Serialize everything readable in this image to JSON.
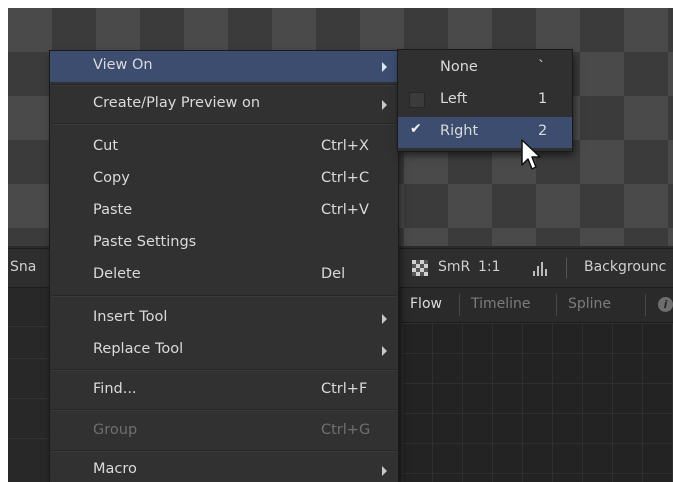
{
  "toolbar": {
    "left_text": "Sna",
    "smr_label": "SmR",
    "ratio_label": "1:1",
    "background_label": "Backgrounc"
  },
  "tabs": [
    {
      "label": "Flow",
      "active": true
    },
    {
      "label": "Timeline",
      "active": false
    },
    {
      "label": "Spline",
      "active": false
    }
  ],
  "context_menu": {
    "items": [
      {
        "label": "View On",
        "shortcut": "",
        "submenu": true,
        "highlighted": true
      },
      {
        "label": "Create/Play Preview on",
        "shortcut": "",
        "submenu": true
      },
      {
        "label": "Cut",
        "shortcut": "Ctrl+X"
      },
      {
        "label": "Copy",
        "shortcut": "Ctrl+C"
      },
      {
        "label": "Paste",
        "shortcut": "Ctrl+V"
      },
      {
        "label": "Paste Settings",
        "shortcut": ""
      },
      {
        "label": "Delete",
        "shortcut": "Del"
      },
      {
        "label": "Insert Tool",
        "shortcut": "",
        "submenu": true
      },
      {
        "label": "Replace Tool",
        "shortcut": "",
        "submenu": true
      },
      {
        "label": "Find...",
        "shortcut": "Ctrl+F"
      },
      {
        "label": "Group",
        "shortcut": "Ctrl+G",
        "disabled": true
      },
      {
        "label": "Macro",
        "shortcut": "",
        "submenu": true
      }
    ]
  },
  "submenu": {
    "items": [
      {
        "label": "None",
        "shortcut": "`"
      },
      {
        "label": "Left",
        "shortcut": "1",
        "checked": false
      },
      {
        "label": "Right",
        "shortcut": "2",
        "checked": true,
        "highlighted": true
      }
    ]
  },
  "colors": {
    "highlight": "#3c4d70",
    "menu_bg": "#313131",
    "text": "#dadada",
    "disabled_text": "#6f6f6f"
  }
}
